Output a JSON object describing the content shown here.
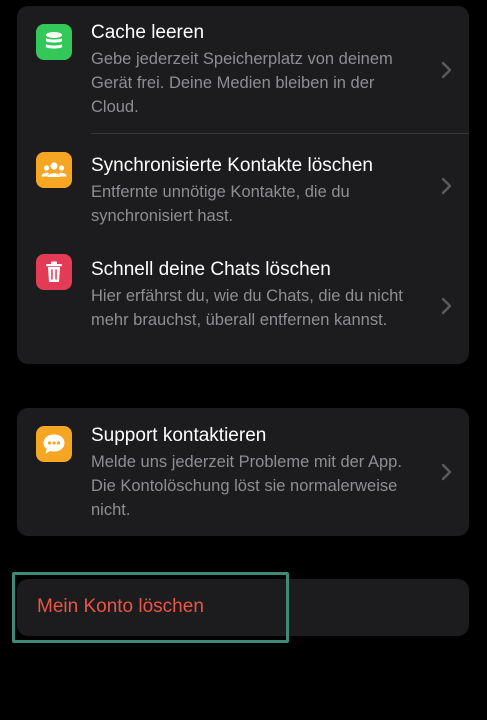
{
  "storage_section": {
    "items": [
      {
        "title": "Cache leeren",
        "description": "Gebe jederzeit Speicherplatz von deinem Gerät frei. Deine Medien bleiben in der Cloud.",
        "icon": "database-icon",
        "icon_color": "#34c759"
      },
      {
        "title": "Synchronisierte Kontakte löschen",
        "description": "Entfernte unnötige Kontakte, die du synchronisiert hast.",
        "icon": "people-icon",
        "icon_color": "#f5a623"
      },
      {
        "title": "Schnell deine Chats löschen",
        "description": "Hier erfährst du, wie du Chats, die du nicht mehr brauchst, überall entfernen kannst.",
        "icon": "trash-icon",
        "icon_color": "#e33a55"
      }
    ]
  },
  "support_section": {
    "title": "Support kontaktieren",
    "description": "Melde uns jederzeit Probleme mit der App. Die Kontolöschung löst sie normalerweise nicht.",
    "icon": "chat-bubble-icon",
    "icon_color": "#f5a623"
  },
  "danger_section": {
    "delete_label": "Mein Konto löschen",
    "label_color": "#eb5545",
    "highlight_color": "#3f8a77"
  }
}
